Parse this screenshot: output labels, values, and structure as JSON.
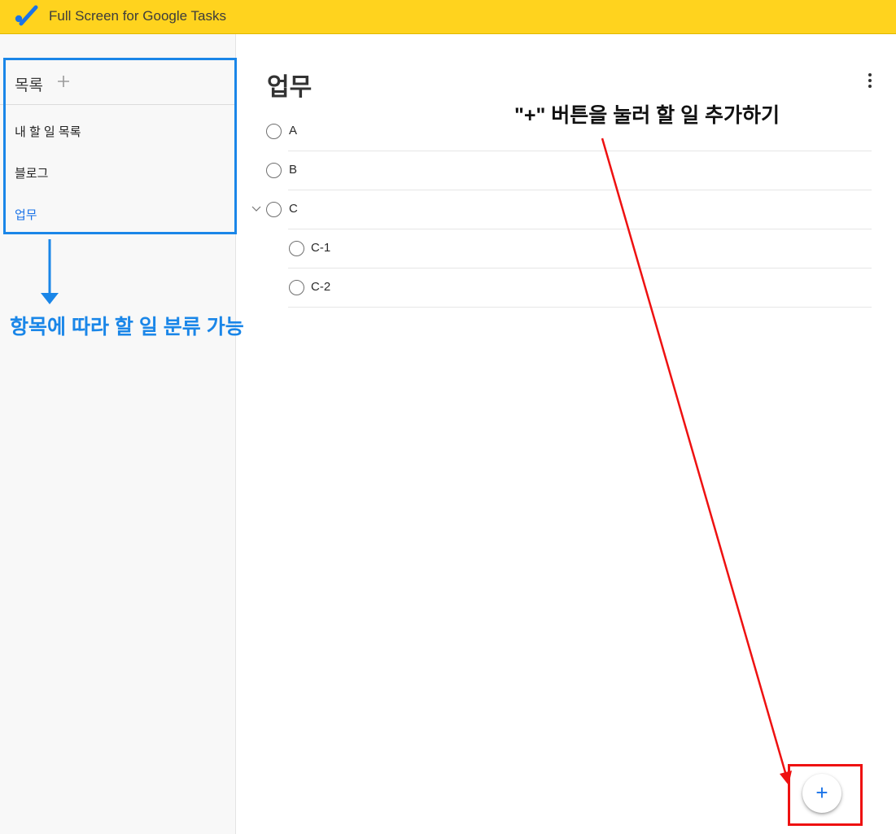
{
  "app": {
    "title": "Full Screen for Google Tasks",
    "bar_color": "#ffd31e",
    "logo_icon": "checkmark-logo-icon"
  },
  "sidebar": {
    "title": "목록",
    "add_icon": "plus-icon",
    "items": [
      {
        "label": "내 할 일 목록",
        "active": false
      },
      {
        "label": "블로그",
        "active": false
      },
      {
        "label": "업무",
        "active": true
      }
    ]
  },
  "main": {
    "title": "업무",
    "menu_icon": "more-vertical-icon",
    "tasks": [
      {
        "title": "A"
      },
      {
        "title": "B"
      },
      {
        "title": "C",
        "expanded": true
      },
      {
        "title": "C-1",
        "subtask": true
      },
      {
        "title": "C-2",
        "subtask": true
      }
    ],
    "fab_label": "+"
  },
  "annotations": {
    "sidebar_note": "항목에 따라 할 일 분류 가능",
    "fab_note": "\"+\" 버튼을 눌러 할 일 추가하기",
    "colors": {
      "blue": "#1a86e8",
      "red": "#ee1111"
    }
  }
}
